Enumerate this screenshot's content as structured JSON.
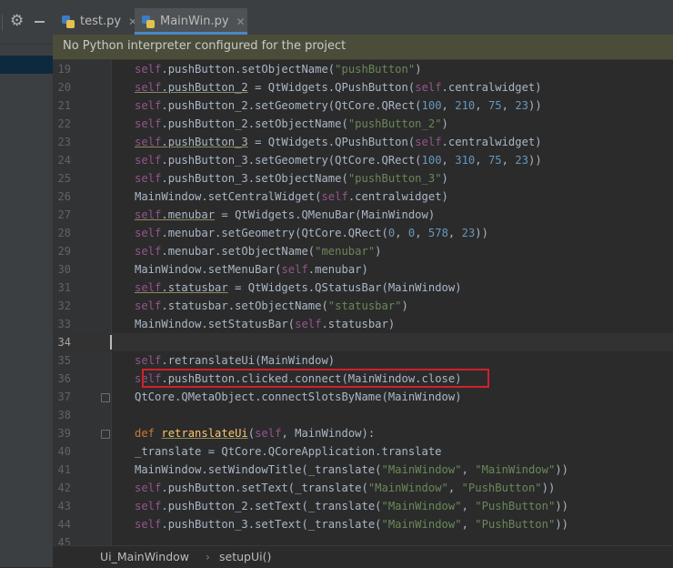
{
  "toolbar": {
    "settings_icon": "gear-icon",
    "hide_icon": "minus-icon"
  },
  "tabs": [
    {
      "label": "test.py",
      "icon": "python-file-icon",
      "active": false
    },
    {
      "label": "MainWin.py",
      "icon": "python-file-icon",
      "active": true
    }
  ],
  "banner": {
    "text": "No Python interpreter configured for the project"
  },
  "editor": {
    "line_numbers": [
      "19",
      "20",
      "21",
      "22",
      "23",
      "24",
      "25",
      "26",
      "27",
      "28",
      "29",
      "30",
      "31",
      "32",
      "33",
      "34",
      "35",
      "36",
      "37",
      "38",
      "39",
      "40",
      "41",
      "42",
      "43",
      "44",
      "45"
    ],
    "current_line": "34",
    "highlighted_line": "36",
    "highlight_color": "#d0212b"
  },
  "breadcrumb": {
    "class_name": "Ui_MainWindow",
    "method_name": "setupUi()"
  }
}
